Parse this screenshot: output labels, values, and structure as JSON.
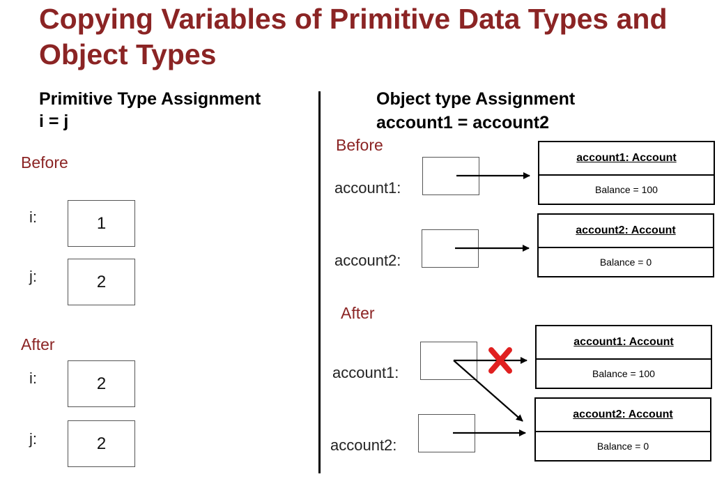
{
  "title": "Copying Variables of Primitive Data Types and Object Types",
  "left": {
    "heading": "Primitive Type Assignment",
    "statement": "i = j",
    "before_label": "Before",
    "after_label": "After",
    "before": [
      {
        "name": "i:",
        "value": "1"
      },
      {
        "name": "j:",
        "value": "2"
      }
    ],
    "after": [
      {
        "name": "i:",
        "value": "2"
      },
      {
        "name": "j:",
        "value": "2"
      }
    ]
  },
  "right": {
    "heading": "Object type Assignment",
    "statement": "account1 = account2",
    "before_label": "Before",
    "after_label": "After",
    "before": {
      "var1": "account1:",
      "var2": "account2:",
      "obj1_name": "account1: Account",
      "obj1_attr": "Balance = 100",
      "obj2_name": "account2: Account",
      "obj2_attr": "Balance = 0"
    },
    "after": {
      "var1": "account1:",
      "var2": "account2:",
      "obj1_name": "account1: Account",
      "obj1_attr": "Balance = 100",
      "obj2_name": "account2: Account",
      "obj2_attr": "Balance = 0"
    }
  },
  "colors": {
    "accent": "#8b2424",
    "cross": "#e02020"
  }
}
